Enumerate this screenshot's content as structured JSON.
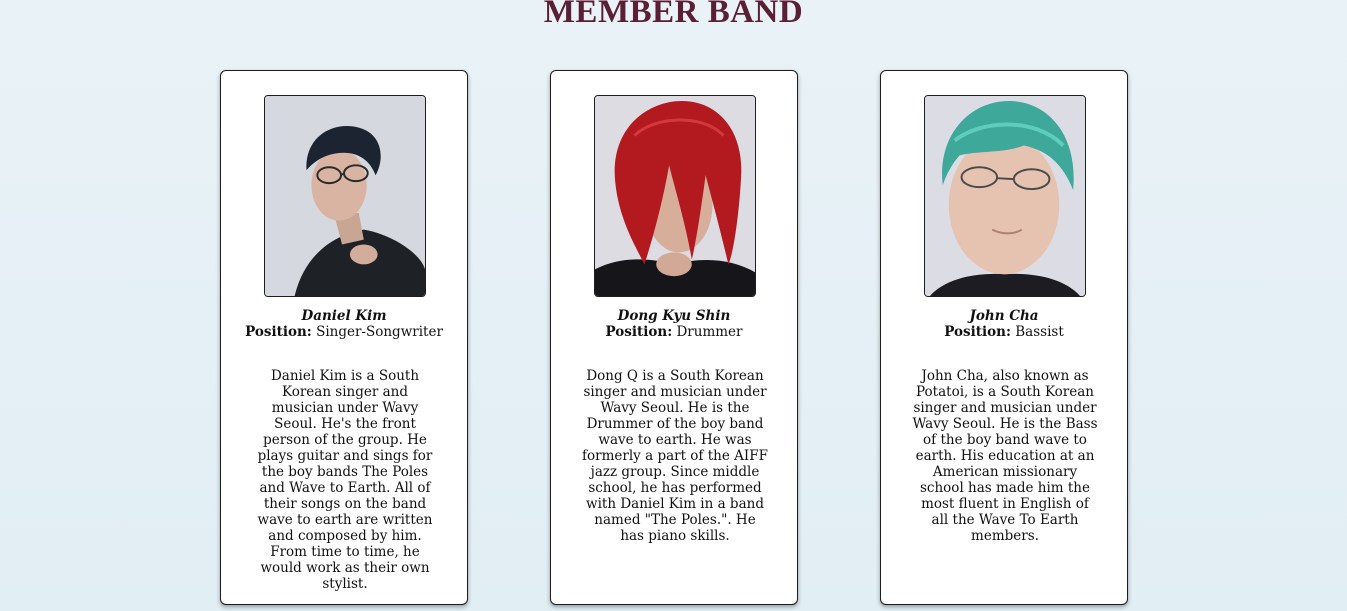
{
  "page": {
    "title": "MEMBER BAND"
  },
  "members": [
    {
      "name": "Daniel Kim",
      "position_label": "Position:",
      "position": "Singer-Songwriter",
      "bio": "Daniel Kim is a South Korean singer and musician under Wavy Seoul. He's the front person of the group. He plays guitar and sings for the boy bands The Poles and Wave to Earth. All of their songs on the band wave to earth are written and composed by him. From time to time, he would work as their own stylist."
    },
    {
      "name": "Dong Kyu Shin",
      "position_label": "Position:",
      "position": "Drummer",
      "bio": "Dong Q is a South Korean singer and musician under Wavy Seoul. He is the Drummer of the boy band wave to earth. He was formerly a part of the AIFF jazz group. Since middle school, he has performed with Daniel Kim in a band named \"The Poles.\". He has piano skills."
    },
    {
      "name": "John Cha",
      "position_label": "Position:",
      "position": "Bassist",
      "bio": "John Cha, also known as Potatoi, is a South Korean singer and musician under Wavy Seoul. He is the Bass of the boy band wave to earth. His education at an American missionary school has made him the most fluent in English of all the Wave To Earth members."
    }
  ],
  "colors": {
    "title": "#5a1f34",
    "background": "#e5f0f5",
    "card": "#ffffff",
    "border": "#1d1d1d"
  }
}
